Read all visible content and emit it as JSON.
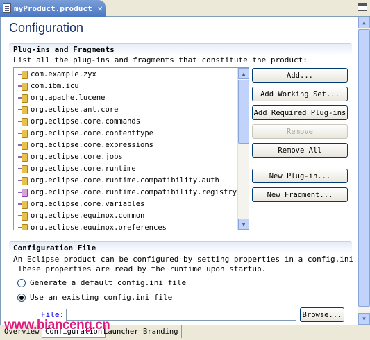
{
  "editor_tab": {
    "title": "myProduct.product",
    "close": "✕"
  },
  "page_title": "Configuration",
  "plugins_section": {
    "title": "Plug-ins and Fragments",
    "description": "List all the plug-ins and fragments that constitute the product:",
    "items": [
      "com.example.zyx",
      "com.ibm.icu",
      "org.apache.lucene",
      "org.eclipse.ant.core",
      "org.eclipse.core.commands",
      "org.eclipse.core.contenttype",
      "org.eclipse.core.expressions",
      "org.eclipse.core.jobs",
      "org.eclipse.core.runtime",
      "org.eclipse.core.runtime.compatibility.auth",
      "org.eclipse.core.runtime.compatibility.registry",
      "org.eclipse.core.variables",
      "org.eclipse.equinox.common",
      "org.eclipse.equinox.preferences"
    ],
    "buttons": {
      "add": "Add...",
      "add_working_set": "Add Working Set...",
      "add_required": "Add Required Plug-ins",
      "remove": "Remove",
      "remove_all": "Remove All",
      "new_plugin": "New Plug-in...",
      "new_fragment": "New Fragment..."
    }
  },
  "config_section": {
    "title": "Configuration File",
    "description": "An Eclipse product can be configured by setting properties in a config.ini file.\n These properties are read by the runtime upon startup.",
    "option_default": "Generate a default config.ini file",
    "option_existing": "Use an existing config.ini file",
    "file_label": "File:",
    "file_value": "",
    "browse": "Browse..."
  },
  "page_tabs": [
    "Overview",
    "Configuration",
    "Launcher",
    "Branding"
  ],
  "watermark": "www.bianceng.cn",
  "scroll_arrows": {
    "up": "▲",
    "down": "▼"
  }
}
